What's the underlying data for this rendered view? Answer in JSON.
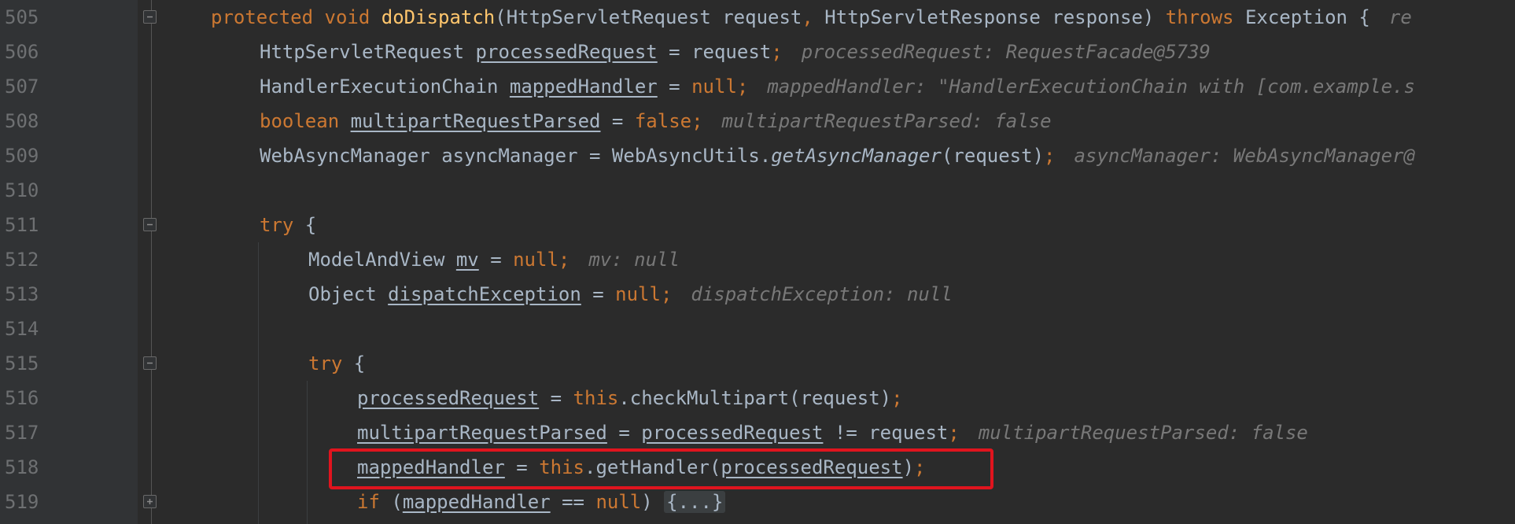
{
  "editor": {
    "lines": [
      {
        "num": "505",
        "segments": [
          {
            "t": "protected void ",
            "c": "kw"
          },
          {
            "t": "doDispatch",
            "c": "fn"
          },
          {
            "t": "(HttpServletRequest request"
          },
          {
            "t": ", ",
            "c": "kw"
          },
          {
            "t": "HttpServletResponse response) "
          },
          {
            "t": "throws ",
            "c": "kw"
          },
          {
            "t": "Exception {"
          },
          {
            "t": "re",
            "c": "hint"
          }
        ]
      },
      {
        "num": "506",
        "segments": [
          {
            "t": "HttpServletRequest "
          },
          {
            "t": "processedRequest",
            "c": "ul"
          },
          {
            "t": " = request"
          },
          {
            "t": ";",
            "c": "kw"
          },
          {
            "t": "processedRequest: RequestFacade@5739",
            "c": "hint"
          }
        ]
      },
      {
        "num": "507",
        "segments": [
          {
            "t": "HandlerExecutionChain "
          },
          {
            "t": "mappedHandler",
            "c": "ul"
          },
          {
            "t": " = "
          },
          {
            "t": "null;",
            "c": "kw"
          },
          {
            "t": "mappedHandler: \"HandlerExecutionChain with [com.example.s",
            "c": "hint"
          }
        ]
      },
      {
        "num": "508",
        "segments": [
          {
            "t": "boolean ",
            "c": "kw"
          },
          {
            "t": "multipartRequestParsed",
            "c": "ul"
          },
          {
            "t": " = "
          },
          {
            "t": "false;",
            "c": "kw"
          },
          {
            "t": "multipartRequestParsed: false",
            "c": "hint"
          }
        ]
      },
      {
        "num": "509",
        "segments": [
          {
            "t": "WebAsyncManager asyncManager = WebAsyncUtils."
          },
          {
            "t": "getAsyncManager",
            "c": "it"
          },
          {
            "t": "(request)"
          },
          {
            "t": ";",
            "c": "kw"
          },
          {
            "t": "asyncManager: WebAsyncManager@",
            "c": "hint"
          }
        ]
      },
      {
        "num": "510",
        "segments": []
      },
      {
        "num": "511",
        "segments": [
          {
            "t": "try ",
            "c": "kw"
          },
          {
            "t": "{"
          }
        ]
      },
      {
        "num": "512",
        "segments": [
          {
            "t": "ModelAndView "
          },
          {
            "t": "mv",
            "c": "ul"
          },
          {
            "t": " = "
          },
          {
            "t": "null;",
            "c": "kw"
          },
          {
            "t": "mv: null",
            "c": "hint"
          }
        ]
      },
      {
        "num": "513",
        "segments": [
          {
            "t": "Object "
          },
          {
            "t": "dispatchException",
            "c": "ul"
          },
          {
            "t": " = "
          },
          {
            "t": "null;",
            "c": "kw"
          },
          {
            "t": "dispatchException: null",
            "c": "hint"
          }
        ]
      },
      {
        "num": "514",
        "segments": []
      },
      {
        "num": "515",
        "segments": [
          {
            "t": "try ",
            "c": "kw"
          },
          {
            "t": "{"
          }
        ]
      },
      {
        "num": "516",
        "segments": [
          {
            "t": "processedRequest",
            "c": "ul"
          },
          {
            "t": " = "
          },
          {
            "t": "this",
            "c": "kw"
          },
          {
            "t": ".checkMultipart(request)"
          },
          {
            "t": ";",
            "c": "kw"
          }
        ]
      },
      {
        "num": "517",
        "segments": [
          {
            "t": "multipartRequestParsed",
            "c": "ul"
          },
          {
            "t": " = "
          },
          {
            "t": "processedRequest",
            "c": "ul"
          },
          {
            "t": " != request"
          },
          {
            "t": ";",
            "c": "kw"
          },
          {
            "t": "multipartRequestParsed: false",
            "c": "hint"
          }
        ]
      },
      {
        "num": "518",
        "segments": [
          {
            "t": "mappedHandler",
            "c": "ul"
          },
          {
            "t": " = "
          },
          {
            "t": "this",
            "c": "kw"
          },
          {
            "t": ".getHandler("
          },
          {
            "t": "processedRequest",
            "c": "ul"
          },
          {
            "t": ")"
          },
          {
            "t": ";",
            "c": "kw"
          }
        ]
      },
      {
        "num": "519",
        "segments": [
          {
            "t": "if ",
            "c": "kw"
          },
          {
            "t": "("
          },
          {
            "t": "mappedHandler",
            "c": "ul"
          },
          {
            "t": " == "
          },
          {
            "t": "null",
            "c": "kw"
          },
          {
            "t": ") "
          },
          {
            "t": "{...}",
            "c": "fold-collapsed"
          }
        ]
      }
    ]
  },
  "colors": {
    "background": "#2b2b2b",
    "keyword": "#cc7832",
    "method_declaration": "#ffc66d",
    "default_text": "#a9b7c6",
    "inline_hint": "#787878",
    "highlight_box": "#e0141e"
  }
}
